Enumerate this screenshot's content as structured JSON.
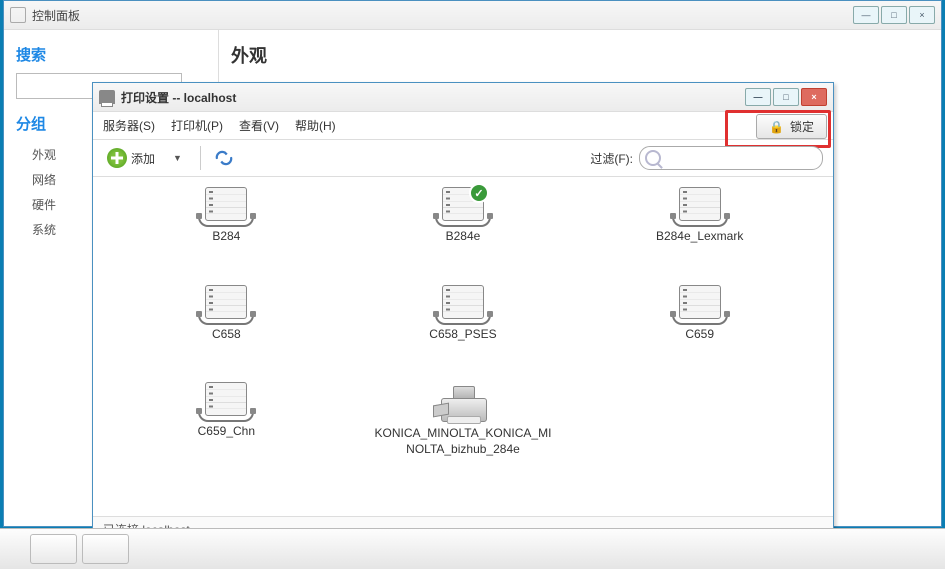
{
  "cp": {
    "title": "控制面板",
    "search_h": "搜索",
    "group_h": "分组",
    "items": [
      "外观",
      "网络",
      "硬件",
      "系统"
    ],
    "main_h": "外观"
  },
  "ps": {
    "title": "打印设置 -- localhost",
    "menu": {
      "server": "服务器(S)",
      "printer": "打印机(P)",
      "view": "查看(V)",
      "help": "帮助(H)"
    },
    "lock": "锁定",
    "add": "添加",
    "filter_label": "过滤(F):",
    "status": "已连接 localhost",
    "printers": [
      {
        "name": "B284",
        "type": "server",
        "default": false
      },
      {
        "name": "B284e",
        "type": "server",
        "default": true
      },
      {
        "name": "B284e_Lexmark",
        "type": "server",
        "default": false
      },
      {
        "name": "C658",
        "type": "server",
        "default": false
      },
      {
        "name": "C658_PSES",
        "type": "server",
        "default": false
      },
      {
        "name": "C659",
        "type": "server",
        "default": false
      },
      {
        "name": "C659_Chn",
        "type": "server",
        "default": false
      },
      {
        "name": "KONICA_MINOLTA_KONICA_MINOLTA_bizhub_284e",
        "type": "km",
        "default": false
      }
    ]
  }
}
